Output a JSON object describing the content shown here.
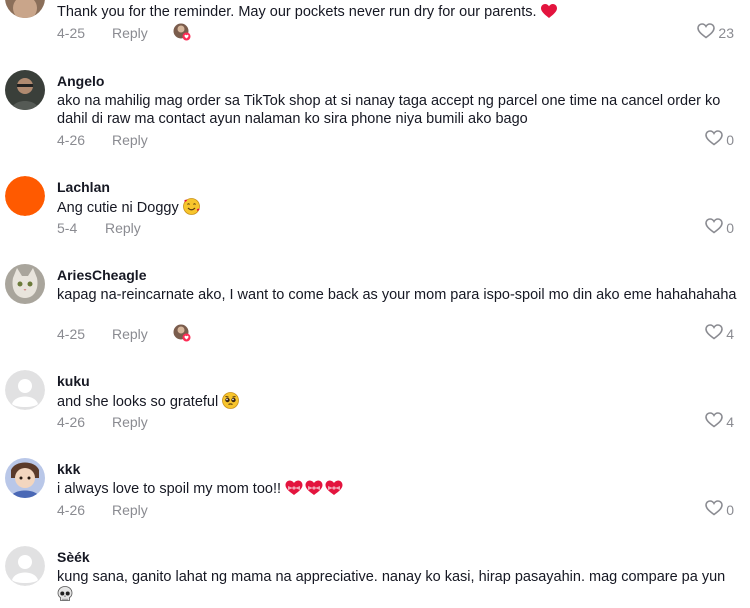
{
  "comments": [
    {
      "username": "",
      "text": "Thank you for the reminder. May our pockets never run dry for our parents.",
      "emojis_after": [
        "red-heart"
      ],
      "date": "4-25",
      "reply_label": "Reply",
      "creator_liked": true,
      "likes": "23",
      "avatar": "photo"
    },
    {
      "username": "Angelo",
      "text": "ako na mahilig mag order sa TikTok shop at si nanay taga accept ng parcel one time na cancel order ko dahil di raw ma contact ayun nalaman ko sira phone niya bumili ako bago",
      "date": "4-26",
      "reply_label": "Reply",
      "creator_liked": false,
      "likes": "0",
      "avatar": "photo"
    },
    {
      "username": "Lachlan",
      "text": "Ang cutie ni Doggy",
      "emojis_after": [
        "smiling-face-with-hearts"
      ],
      "date": "5-4",
      "reply_label": "Reply",
      "creator_liked": false,
      "likes": "0",
      "avatar": "orange-circle",
      "avatar_color": "#ff5a00"
    },
    {
      "username": "AriesCheagle",
      "text": "kapag na-reincarnate ako, I want to come back as your mom para ispo-spoil mo din ako eme hahahahaha",
      "date": "4-25",
      "reply_label": "Reply",
      "creator_liked": true,
      "likes": "4",
      "avatar": "cat-photo"
    },
    {
      "username": "kuku",
      "text": "and she looks so grateful",
      "emojis_after": [
        "pleading-face"
      ],
      "date": "4-26",
      "reply_label": "Reply",
      "creator_liked": false,
      "likes": "4",
      "avatar": "default-gray"
    },
    {
      "username": "kkk",
      "text": "i always love to spoil my mom too!!",
      "emojis_after": [
        "heart-with-ribbon",
        "heart-with-ribbon",
        "heart-with-ribbon"
      ],
      "date": "4-26",
      "reply_label": "Reply",
      "creator_liked": false,
      "likes": "0",
      "avatar": "cartoon"
    },
    {
      "username": "Sèék",
      "text": "kung sana, ganito lahat ng mama na appreciative. nanay ko kasi, hirap pasayahin. mag compare pa yun",
      "emojis_after": [
        "skull"
      ],
      "avatar": "default-gray"
    }
  ],
  "colors": {
    "text": "#161823",
    "secondary": "#8a8b91",
    "heart_emoji": "#e3143e",
    "accent_pink": "#fe2c55"
  }
}
